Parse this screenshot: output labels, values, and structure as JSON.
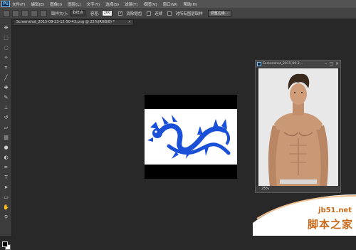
{
  "app": {
    "logo": "Ps"
  },
  "menu": [
    "文件(F)",
    "编辑(E)",
    "图像(I)",
    "图层(L)",
    "文字(Y)",
    "选择(S)",
    "滤镜(T)",
    "视图(V)",
    "窗口(W)",
    "帮助(H)"
  ],
  "options": {
    "size_label": "取样大小:",
    "size_value": "取样点",
    "tolerance_label": "容差:",
    "tolerance_value": "200",
    "antialias_label": "消除锯齿",
    "contiguous_label": "连续",
    "all_layers_label": "对所有图层取样",
    "refine_edge_label": "调整边缘..."
  },
  "document_tab": {
    "label": "Screenshot_2015-09-23-12-50-43.png @ 25%(RGB/8) *",
    "close": "×"
  },
  "float_window": {
    "title": "Screenshot_2015-09-2...",
    "zoom": "25%"
  },
  "watermark": {
    "url": "jb51.net",
    "title": "脚本之家"
  },
  "colors": {
    "accent": "#7ac0f0",
    "dragon": "#1a4fd8",
    "watermark": "#c96a1a"
  },
  "tool_icons": [
    "move-icon",
    "marquee-icon",
    "lasso-icon",
    "magic-wand-icon",
    "crop-icon",
    "eyedropper-icon",
    "healing-icon",
    "brush-icon",
    "clone-stamp-icon",
    "history-brush-icon",
    "eraser-icon",
    "gradient-icon",
    "blur-icon",
    "dodge-icon",
    "pen-icon",
    "type-icon",
    "path-select-icon",
    "shape-icon",
    "hand-icon",
    "zoom-icon"
  ]
}
